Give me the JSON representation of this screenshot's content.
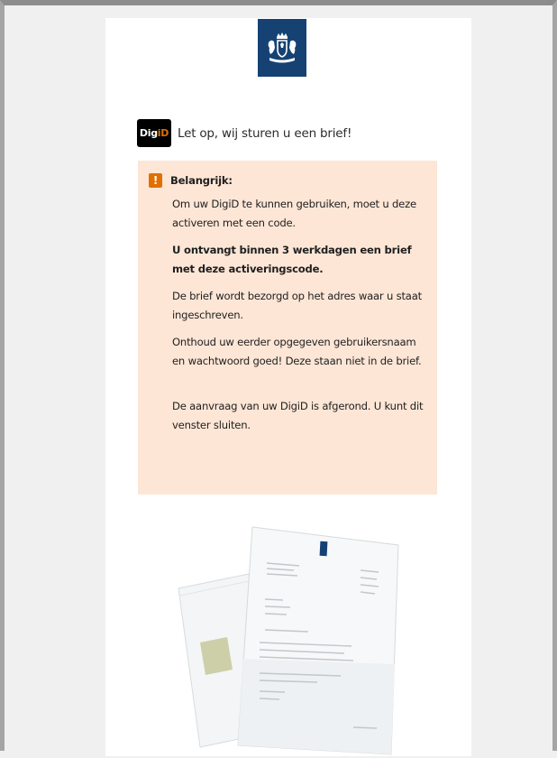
{
  "header": {
    "logo_icon": "rijksoverheid-coat-of-arms-icon",
    "brand_color": "#154273"
  },
  "digid": {
    "logo_white": "Dig",
    "logo_orange": "iD",
    "heading": "Let op, wij sturen u een brief!"
  },
  "notice": {
    "icon": "exclamation-icon",
    "accent_color": "#e17000",
    "background_color": "#fde6d6",
    "title": "Belangrijk:",
    "p1": "Om uw DigiD te kunnen gebruiken, moet u deze activeren met een code.",
    "p2": "U ontvangt binnen 3 werkdagen een brief met deze activeringscode.",
    "p3": "De brief wordt bezorgd op het adres waar u staat ingeschreven.",
    "p4": "Onthoud uw eerder opgegeven gebruikersnaam en wachtwoord goed! Deze staan niet in de brief.",
    "p5": "De aanvraag van uw DigiD is afgerond. U kunt dit venster sluiten."
  },
  "illustration": {
    "icon": "envelope-and-letter-image"
  }
}
